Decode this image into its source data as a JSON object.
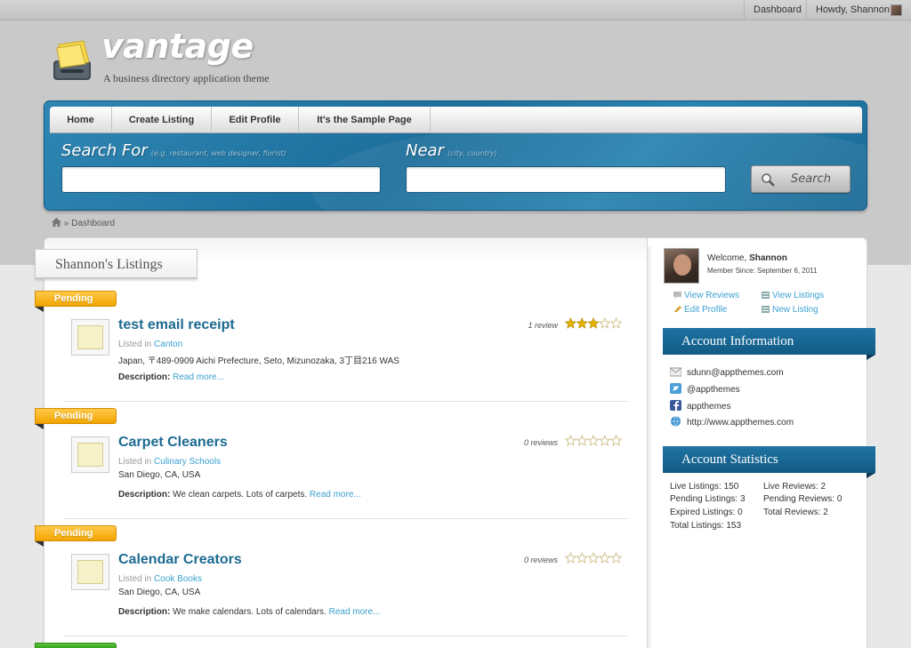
{
  "adminbar": {
    "dashboard": "Dashboard",
    "howdy": "Howdy, Shannon"
  },
  "site": {
    "title": "vantage",
    "tagline": "A business directory application theme"
  },
  "nav": [
    {
      "label": "Home"
    },
    {
      "label": "Create Listing"
    },
    {
      "label": "Edit Profile"
    },
    {
      "label": "It's the Sample Page"
    }
  ],
  "search": {
    "for_label": "Search For",
    "for_hint": "(e.g. restaurant, web designer, florist)",
    "for_value": "",
    "near_label": "Near",
    "near_hint": "(city, country)",
    "near_value": "",
    "button": "Search"
  },
  "breadcrumb": {
    "sep": "»",
    "current": "Dashboard"
  },
  "main": {
    "tab": "Shannon's Listings",
    "listings": [
      {
        "status": "Pending",
        "title": "test email receipt",
        "listed_in_prefix": "Listed in",
        "category": "Canton",
        "address": "Japan, 〒489-0909 Aichi Prefecture, Seto, Mizunozaka, 3丁目216 WAS",
        "desc_label": "Description:",
        "desc": "",
        "read_more": "Read more...",
        "reviews": "1 review",
        "rating": 3
      },
      {
        "status": "Pending",
        "title": "Carpet Cleaners",
        "listed_in_prefix": "Listed in",
        "category": "Culinary Schools",
        "address": "San Diego, CA, USA",
        "desc_label": "Description:",
        "desc": "We clean carpets. Lots of carpets.",
        "read_more": "Read more...",
        "reviews": "0 reviews",
        "rating": 0
      },
      {
        "status": "Pending",
        "title": "Calendar Creators",
        "listed_in_prefix": "Listed in",
        "category": "Cook Books",
        "address": "San Diego, CA, USA",
        "desc_label": "Description:",
        "desc": "We make calendars. Lots of calendars.",
        "read_more": "Read more...",
        "reviews": "0 reviews",
        "rating": 0
      }
    ]
  },
  "sidebar": {
    "welcome_prefix": "Welcome,",
    "user": "Shannon",
    "member_since": "Member Since: September 6, 2011",
    "links": {
      "view_reviews": "View Reviews",
      "view_listings": "View Listings",
      "edit_profile": "Edit Profile",
      "new_listing": "New Listing"
    },
    "account_info_title": "Account Information",
    "account_info": {
      "email": "sdunn@appthemes.com",
      "twitter": "@appthemes",
      "facebook": "appthemes",
      "website": "http://www.appthemes.com"
    },
    "account_stats_title": "Account Statistics",
    "stats": {
      "live_listings": "Live Listings: 150",
      "pending_listings": "Pending Listings: 3",
      "expired_listings": "Expired Listings: 0",
      "total_listings": "Total Listings: 153",
      "live_reviews": "Live Reviews: 2",
      "pending_reviews": "Pending Reviews: 0",
      "total_reviews": "Total Reviews: 2"
    }
  },
  "colors": {
    "brand_blue": "#1d6f9c",
    "link": "#3aa0d0",
    "pending": "#f2a500",
    "star": "#e8b400"
  }
}
